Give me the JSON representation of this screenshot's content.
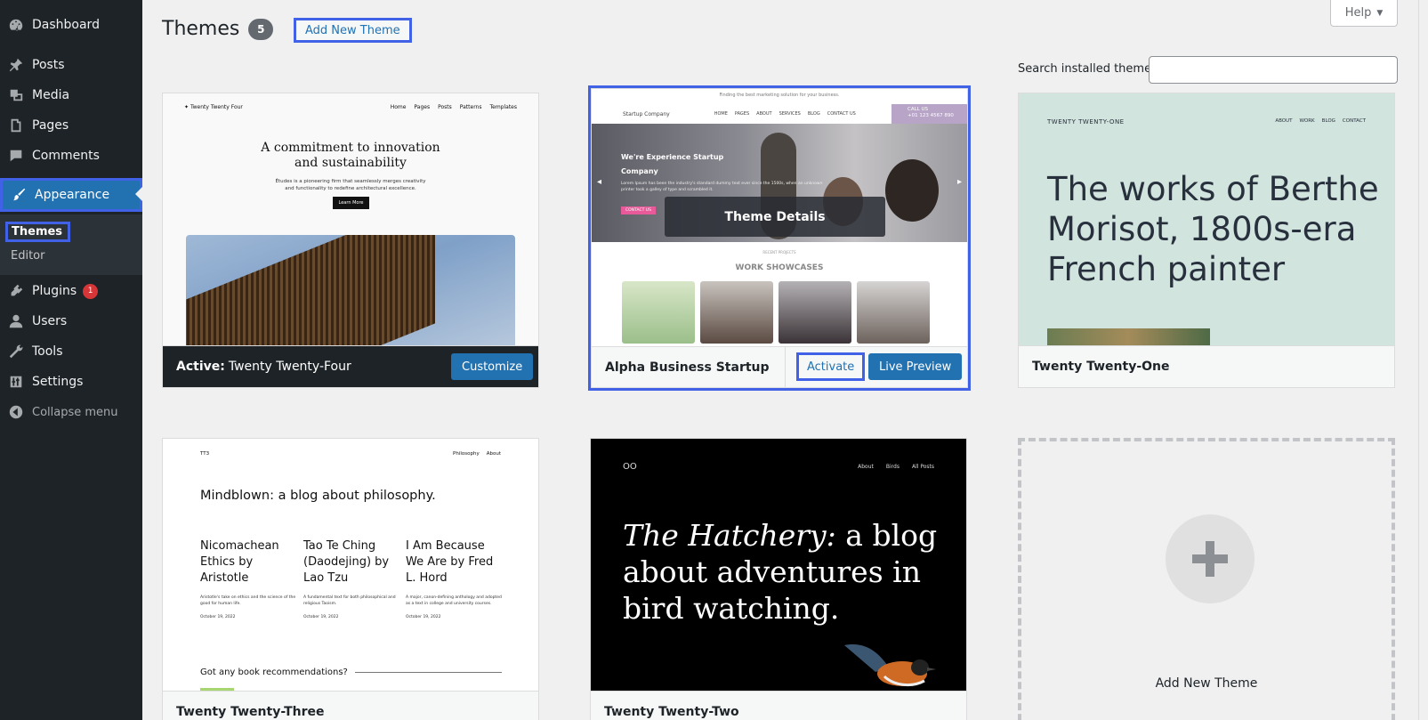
{
  "sidebar": {
    "items": [
      {
        "label": "Dashboard",
        "icon": "dashboard-icon"
      },
      {
        "label": "Posts",
        "icon": "pin-icon"
      },
      {
        "label": "Media",
        "icon": "media-icon"
      },
      {
        "label": "Pages",
        "icon": "pages-icon"
      },
      {
        "label": "Comments",
        "icon": "comments-icon"
      },
      {
        "label": "Appearance",
        "icon": "brush-icon"
      },
      {
        "label": "Plugins",
        "icon": "plugin-icon",
        "badge": "1"
      },
      {
        "label": "Users",
        "icon": "users-icon"
      },
      {
        "label": "Tools",
        "icon": "tools-icon"
      },
      {
        "label": "Settings",
        "icon": "settings-icon"
      }
    ],
    "submenu": [
      {
        "label": "Themes"
      },
      {
        "label": "Editor"
      }
    ],
    "collapse_label": "Collapse menu"
  },
  "header": {
    "title": "Themes",
    "count": "5",
    "add_new_label": "Add New Theme",
    "help_label": "Help",
    "search_label": "Search installed themes",
    "search_value": ""
  },
  "themes": {
    "active": {
      "active_prefix": "Active:",
      "name": "Twenty Twenty-Four",
      "customize_label": "Customize",
      "shot": {
        "brand": "Twenty Twenty Four",
        "nav": [
          "Home",
          "Pages",
          "Posts",
          "Patterns",
          "Templates"
        ],
        "hero_1": "A commitment to innovation",
        "hero_2": "and sustainability",
        "desc_1": "Études is a pioneering firm that seamlessly merges creativity",
        "desc_2": "and functionality to redefine architectural excellence.",
        "button": "Learn More"
      }
    },
    "alpha": {
      "name": "Alpha Business Startup",
      "activate_label": "Activate",
      "preview_label": "Live Preview",
      "details_label": "Theme Details",
      "shot": {
        "topline": "Finding the best marketing solution for your business.",
        "brand": "Startup Company",
        "nav": [
          "HOME",
          "PAGES",
          "ABOUT",
          "SERVICES",
          "BLOG",
          "CONTACT US"
        ],
        "call_1": "CALL US",
        "call_2": "+01 123 4567 890",
        "hero_1": "We're Experience Startup",
        "hero_2": "Company",
        "hero_text": "Lorem Ipsum has been the industry's standard dummy text ever since the 1500s, when an unknown printer took a galley of type and scrambled it.",
        "cta": "CONTACT US",
        "recent": "RECENT PROJECTS",
        "work": "WORK SHOWCASES"
      }
    },
    "tt1": {
      "name": "Twenty Twenty-One",
      "shot": {
        "brand": "TWENTY TWENTY-ONE",
        "nav": [
          "ABOUT",
          "WORK",
          "BLOG",
          "CONTACT"
        ],
        "headline": "The works of Berthe Morisot, 1800s-era French painter"
      }
    },
    "tt3": {
      "name": "Twenty Twenty-Three",
      "shot": {
        "brand": "TT3",
        "nav": [
          "Philosophy",
          "About"
        ],
        "headline": "Mindblown: a blog about philosophy.",
        "posts": [
          {
            "title": "Nicomachean Ethics by Aristotle",
            "desc": "Aristotle's take on ethics and the science of the good for human life.",
            "date": "October 19, 2022"
          },
          {
            "title": "Tao Te Ching (Daodejing) by Lao Tzu",
            "desc": "A fundamental text for both philosophical and religious Taoism.",
            "date": "October 19, 2022"
          },
          {
            "title": "I Am Because We Are by Fred L. Hord",
            "desc": "A major, canon-defining anthology and adopted as a text in college and university courses.",
            "date": "October 19, 2022"
          }
        ],
        "question": "Got any book recommendations?"
      }
    },
    "tt2": {
      "name": "Twenty Twenty-Two",
      "shot": {
        "logo": "OO",
        "nav": [
          "About",
          "Birds",
          "All Posts"
        ],
        "headline_italic": "The Hatchery:",
        "headline_rest": " a blog about adventures in bird watching."
      }
    }
  },
  "add_new_card": {
    "label": "Add New Theme"
  },
  "colors": {
    "sidebar_bg": "#1d2327",
    "accent": "#2271b1",
    "highlight": "#4162e6",
    "badge_red": "#d63638"
  }
}
